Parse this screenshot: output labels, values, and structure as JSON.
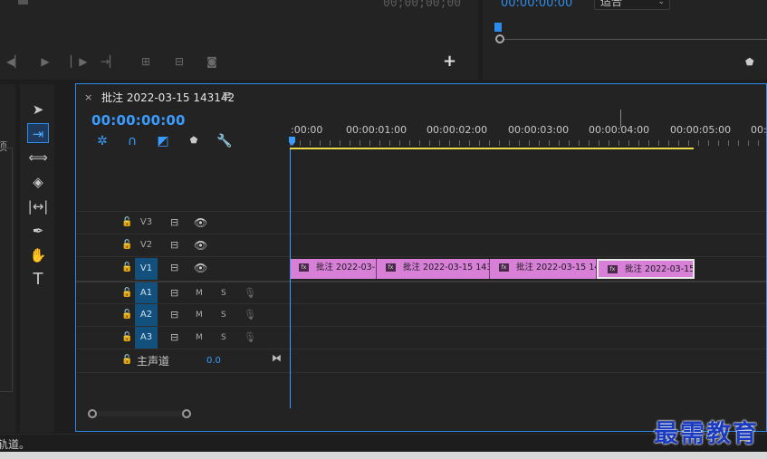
{
  "source_monitor": {
    "timecode": "00;00;00;00",
    "controls": [
      "mark-in-icon",
      "play-icon",
      "step-forward-icon",
      "insert-icon",
      "overwrite-icon",
      "lift-icon",
      "export-frame-icon"
    ],
    "add_label": "+"
  },
  "program_monitor": {
    "timecode": "00:00:00:00",
    "fit_value": "适合"
  },
  "tools": [
    "selection-tool-icon",
    "track-select-tool-icon",
    "ripple-edit-tool-icon",
    "razor-tool-icon",
    "slip-tool-icon",
    "pen-tool-icon",
    "hand-tool-icon",
    "type-tool-icon"
  ],
  "left_panel": {
    "partial_text": "项"
  },
  "timeline": {
    "close_label": "×",
    "title": "批注 2022-03-15 143142",
    "menu_label": "≡",
    "timecode": "00:00:00:00",
    "ruler_labels": [
      ":00:00",
      "00:00:01:00",
      "00:00:02:00",
      "00:00:03:00",
      "00:00:04:00",
      "00:00:05:00",
      "00:0"
    ],
    "video_tracks": [
      {
        "name": "V3"
      },
      {
        "name": "V2"
      },
      {
        "name": "V1"
      }
    ],
    "audio_tracks": [
      {
        "name": "A1",
        "m": "M",
        "s": "S"
      },
      {
        "name": "A2",
        "m": "M",
        "s": "S"
      },
      {
        "name": "A3",
        "m": "M",
        "s": "S"
      }
    ],
    "master": {
      "label": "主声道",
      "value": "0.0"
    },
    "clips": [
      {
        "label": "批注 2022-03-"
      },
      {
        "label": "批注 2022-03-15 143"
      },
      {
        "label": "批注 2022-03-15 14"
      },
      {
        "label": "批注 2022-03-15"
      }
    ]
  },
  "status_bar": {
    "text": "轨道。"
  },
  "watermark": "最需教育",
  "colors": {
    "accent": "#2d8ceb",
    "clip": "#d880d8",
    "workbar": "#e8d84a"
  }
}
